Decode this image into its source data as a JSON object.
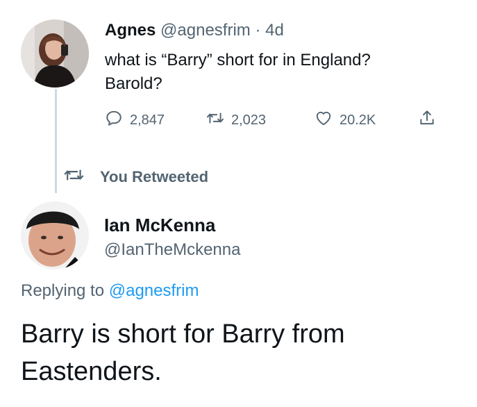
{
  "original_tweet": {
    "author_name": "Agnes",
    "handle": "@agnesfrim",
    "separator": "·",
    "time": "4d",
    "text_line1": "what is “Barry” short for in England?",
    "text_line2": "Barold?",
    "reply_count": "2,847",
    "retweet_count": "2,023",
    "like_count": "20.2K"
  },
  "retweet_banner": {
    "label": "You Retweeted"
  },
  "reply_tweet": {
    "author_name": "Ian McKenna",
    "handle": "@IanTheMckenna",
    "replying_prefix": "Replying to",
    "replying_to": "@agnesfrim",
    "text_line1": "Barry is short for Barry from",
    "text_line2": "Eastenders."
  },
  "colors": {
    "text": "#0f1419",
    "muted": "#536471",
    "link": "#1d9bf0",
    "thread_line": "#cfd9de"
  },
  "icons": [
    "reply-icon",
    "retweet-icon",
    "like-icon",
    "share-icon"
  ]
}
